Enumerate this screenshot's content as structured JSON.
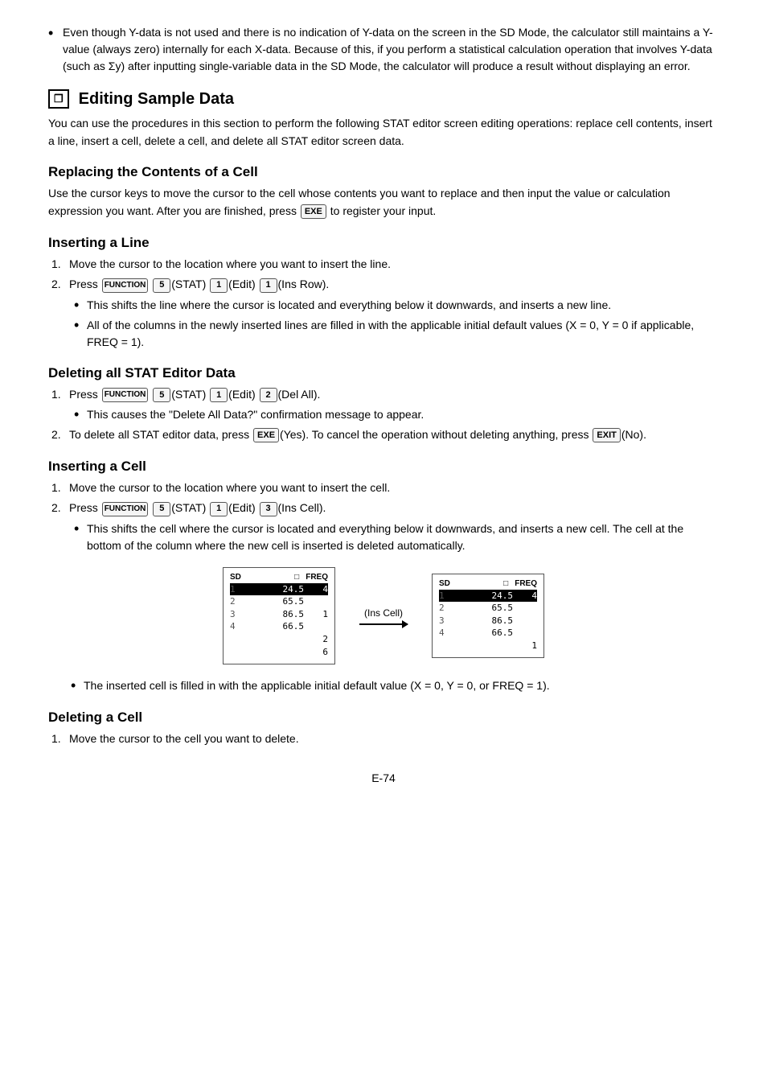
{
  "intro_bullets": [
    "Even though Y-data is not used and there is no indication of Y-data on the screen in the SD Mode, the calculator still maintains a Y-value (always zero) internally for each X-data. Because of this, if you perform a statistical calculation operation that involves Y-data (such as Σy) after inputting single-variable data in the SD Mode, the calculator will produce a result without displaying an error."
  ],
  "section_title": "Editing Sample Data",
  "section_intro": "You can use the procedures in this section to perform the following STAT editor screen editing operations: replace cell contents, insert a line, insert a cell, delete a cell, and delete all STAT editor screen data.",
  "replacing": {
    "heading": "Replacing the Contents of a Cell",
    "body": "Use the cursor keys to move the cursor to the cell whose contents you want to replace and then input the value or calculation expression you want. After you are finished, press",
    "body2": "to register your input.",
    "exe_key": "EXE"
  },
  "inserting_line": {
    "heading": "Inserting a Line",
    "steps": [
      "Move the cursor to the location where you want to insert the line.",
      "Press"
    ],
    "step2_keys": [
      "FUNCTION",
      "5",
      "1",
      "1"
    ],
    "step2_labels": [
      "(STAT)",
      "(Edit)",
      "(Ins Row)"
    ],
    "bullets": [
      "This shifts the line where the cursor is located and everything below it downwards, and inserts a new line.",
      "All of the columns in the newly inserted lines are filled in with the applicable initial default values (X = 0, Y = 0 if applicable, FREQ = 1)."
    ]
  },
  "deleting_all": {
    "heading": "Deleting all STAT Editor Data",
    "steps": [
      "Press",
      "To delete all STAT editor data, press"
    ],
    "step1_keys": [
      "FUNCTION",
      "5",
      "1",
      "2"
    ],
    "step1_labels": [
      "(STAT)",
      "(Edit)",
      "(Del All)"
    ],
    "step1_bullet": "This causes the \"Delete All Data?\" confirmation message to appear.",
    "step2_exe": "EXE",
    "step2_label": "(Yes). To cancel the operation without deleting anything, press",
    "step2_exit": "EXIT",
    "step2_label2": "(No)."
  },
  "inserting_cell": {
    "heading": "Inserting a Cell",
    "steps": [
      "Move the cursor to the location where you want to insert the cell.",
      "Press"
    ],
    "step2_keys": [
      "FUNCTION",
      "5",
      "1",
      "3"
    ],
    "step2_labels": [
      "(STAT)",
      "(Edit)",
      "(Ins Cell)"
    ],
    "bullet": "This shifts the cell where the cursor is located and everything below it downwards, and inserts a new cell. The cell at the bottom of the column where the new cell is inserted is deleted automatically.",
    "diagram_label": "(Ins Cell)",
    "inserted_bullet": "The inserted cell is filled in with the applicable initial default value (X = 0, Y = 0, or FREQ = 1).",
    "screen_left": {
      "header_left": "SD",
      "header_right": "D",
      "col_header": "FREQ",
      "rows": [
        {
          "num": "1",
          "val": "24.5",
          "freq": "4"
        },
        {
          "num": "2",
          "val": "65.5",
          "freq": ""
        },
        {
          "num": "3",
          "val": "86.5",
          "freq": "1"
        },
        {
          "num": "4",
          "val": "66.5",
          "freq": ""
        },
        {
          "num": "",
          "val": "",
          "freq": "2"
        }
      ],
      "bottom": "6"
    },
    "screen_right": {
      "header_left": "SD",
      "header_right": "D",
      "col_header": "FREQ",
      "rows": [
        {
          "num": "1",
          "val": "24.5",
          "freq": "4"
        },
        {
          "num": "2",
          "val": "65.5",
          "freq": ""
        },
        {
          "num": "3",
          "val": "86.5",
          "freq": ""
        },
        {
          "num": "4",
          "val": "66.5",
          "freq": ""
        },
        {
          "num": "",
          "val": "",
          "freq": ""
        }
      ],
      "bottom": "1"
    }
  },
  "deleting_cell": {
    "heading": "Deleting a Cell",
    "steps": [
      "Move the cursor to the cell you want to delete."
    ]
  },
  "page_number": "E-74"
}
